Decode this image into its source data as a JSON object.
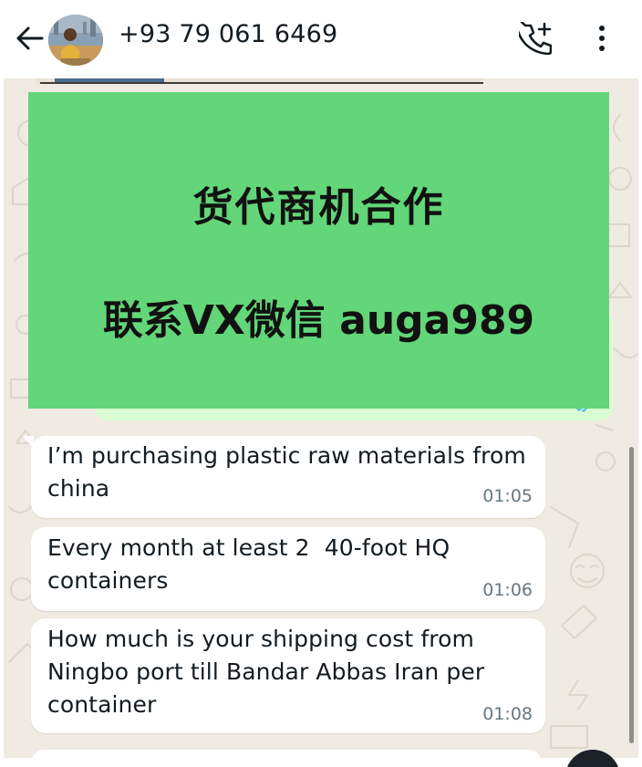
{
  "header": {
    "contact_name": "+93 79 061 6469"
  },
  "icons": {
    "back": "arrow-left-icon",
    "call": "phone-add-icon",
    "menu": "more-vertical-icon",
    "ticks": "double-check-icon"
  },
  "overlay": {
    "line1": "货代商机合作",
    "line2": "联系VX微信 auga989",
    "color": "#62d678"
  },
  "messages": [
    {
      "line1": "I’m purchasing plastic raw materials from",
      "line2": "china",
      "time": "01:05"
    },
    {
      "line1": "Every month at least 2  40-foot HQ",
      "line2": "containers",
      "time": "01:06"
    },
    {
      "line1": "How much is your shipping cost from",
      "line2": "Ningbo port till Bandar Abbas Iran per",
      "line3": "container",
      "time": "01:08"
    }
  ],
  "colors": {
    "chat_background": "#efeae2",
    "incoming_bubble": "#ffffff",
    "outgoing_bubble": "#d9fdd3",
    "read_ticks": "#53bdeb"
  }
}
